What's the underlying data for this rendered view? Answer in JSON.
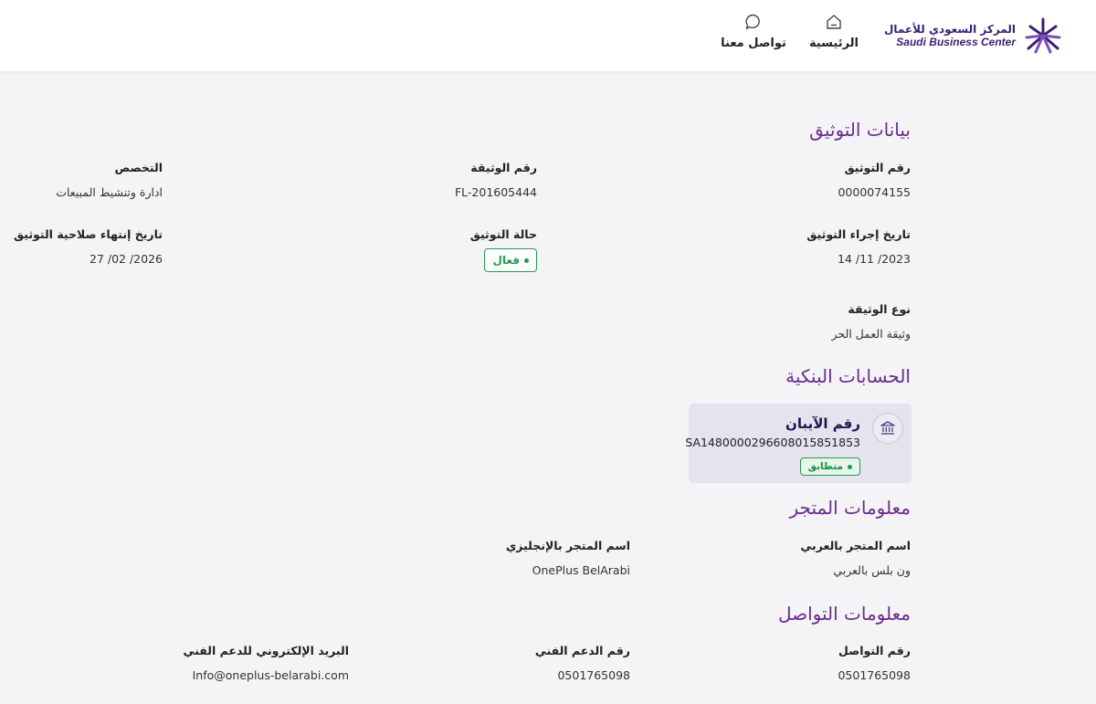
{
  "header": {
    "brand_ar": "المركز السعودي للأعمال",
    "brand_en": "Saudi Business Center",
    "nav": {
      "home_label": "الرئيسية",
      "home_icon": "home-icon",
      "contact_label": "تواصل معنا",
      "contact_icon": "chat-bubble-icon"
    }
  },
  "verification": {
    "title": "بيانات التوثيق",
    "doc_num": {
      "label": "رقم التوثيق",
      "value": "0000074155"
    },
    "doc_id": {
      "label": "رقم الوثيقة",
      "value": "FL-201605444"
    },
    "specialty": {
      "label": "التخصص",
      "value": "ادارة وتنشيط المبيعات"
    },
    "issue_date": {
      "label": "تاريخ إجراء التوثيق",
      "value": "14 /11 /2023"
    },
    "status": {
      "label": "حالة التوثيق",
      "value": "فعال",
      "color": "#1f9d4c"
    },
    "expiry_date": {
      "label": "تاريخ إنتهاء صلاحية التوثيق",
      "value": "27 /02 /2026"
    },
    "doc_type": {
      "label": "نوع الوثيقة",
      "value": "وثيقة العمل الحر"
    }
  },
  "bank": {
    "title": "الحسابات البنكية",
    "iban_title": "رقم الآيبان",
    "iban_number": "SA1480000296608015851853",
    "match_label": "متطابق",
    "icon": "bank-icon"
  },
  "store": {
    "title": "معلومات المتجر",
    "name_ar": {
      "label": "اسم المتجر بالعربي",
      "value": "ون بلس بالعربي"
    },
    "name_en": {
      "label": "اسم المتجر بالإنجليزي",
      "value": "OnePlus BelArabi"
    }
  },
  "contact": {
    "title": "معلومات التواصل",
    "phone": {
      "label": "رقم التواصل",
      "value": "0501765098"
    },
    "support_phone": {
      "label": "رقم الدعم الفني",
      "value": "0501765098"
    },
    "support_email": {
      "label": "البريد الإلكتروني للدعم الفني",
      "value": "Info@oneplus-belarabi.com"
    }
  },
  "colors": {
    "accent": "#6b2c8f",
    "brand": "#3a1f74",
    "success": "#1f9d4c",
    "card": "#e5e3ee"
  }
}
